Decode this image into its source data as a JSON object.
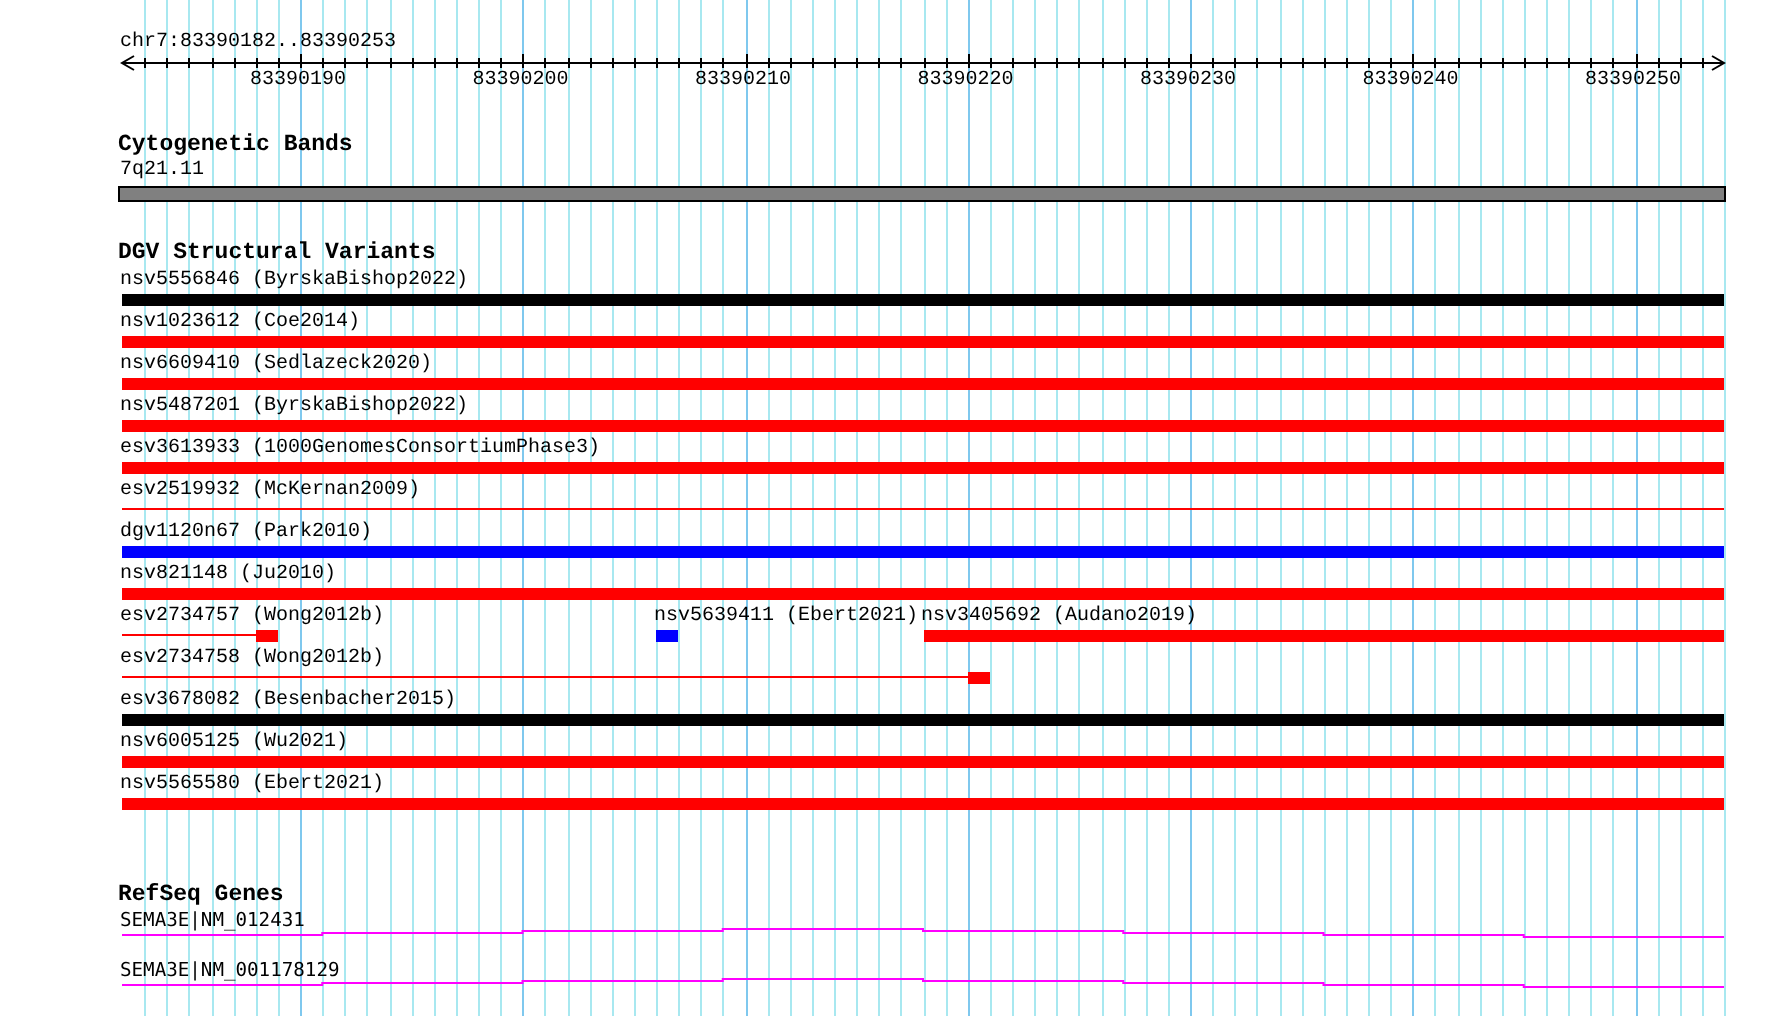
{
  "ruler": {
    "title": "chr7:83390182..83390253",
    "tick_labels": [
      "83390190",
      "83390200",
      "83390210",
      "83390220",
      "83390230",
      "83390240",
      "83390250"
    ]
  },
  "cytogenetic_bands": {
    "title": "Cytogenetic Bands",
    "band": "7q21.11"
  },
  "dgv_structural_variants": {
    "title": "DGV Structural Variants",
    "lanes": [
      {
        "features": [
          {
            "label": "nsv5556846 (ByrskaBishop2022)",
            "kind": "block",
            "color": "#000000"
          }
        ]
      },
      {
        "features": [
          {
            "label": "nsv1023612 (Coe2014)",
            "kind": "block",
            "color": "#ff0000"
          }
        ]
      },
      {
        "features": [
          {
            "label": "nsv6609410 (Sedlazeck2020)",
            "kind": "block",
            "color": "#ff0000"
          }
        ]
      },
      {
        "features": [
          {
            "label": "nsv5487201 (ByrskaBishop2022)",
            "kind": "block",
            "color": "#ff0000"
          }
        ]
      },
      {
        "features": [
          {
            "label": "esv3613933 (1000GenomesConsortiumPhase3)",
            "kind": "block",
            "color": "#ff0000"
          }
        ]
      },
      {
        "features": [
          {
            "label": "esv2519932 (McKernan2009)",
            "kind": "line",
            "color": "#ff0000"
          }
        ]
      },
      {
        "features": [
          {
            "label": "dgv1120n67 (Park2010)",
            "kind": "block",
            "color": "#0000ff"
          }
        ]
      },
      {
        "features": [
          {
            "label": "nsv821148 (Ju2010)",
            "kind": "block",
            "color": "#ff0000"
          }
        ]
      },
      {
        "features": [
          {
            "label": "esv2734757 (Wong2012b)",
            "kind": "split",
            "color": "#ff0000"
          },
          {
            "label": "nsv5639411 (Ebert2021)",
            "kind": "block",
            "color": "#0000ff"
          },
          {
            "label": "nsv3405692 (Audano2019)",
            "kind": "block",
            "color": "#ff0000"
          }
        ]
      },
      {
        "features": [
          {
            "label": "esv2734758 (Wong2012b)",
            "kind": "split",
            "color": "#ff0000"
          }
        ]
      },
      {
        "features": [
          {
            "label": "esv3678082 (Besenbacher2015)",
            "kind": "block",
            "color": "#000000"
          }
        ]
      },
      {
        "features": [
          {
            "label": "nsv6005125 (Wu2021)",
            "kind": "block",
            "color": "#ff0000"
          }
        ]
      },
      {
        "features": [
          {
            "label": "nsv5565580 (Ebert2021)",
            "kind": "block",
            "color": "#ff0000"
          }
        ]
      }
    ]
  },
  "refseq_genes": {
    "title": "RefSeq Genes",
    "transcripts": [
      {
        "label": "SEMA3E|NM_012431"
      },
      {
        "label": "SEMA3E|NM_001178129"
      }
    ]
  }
}
